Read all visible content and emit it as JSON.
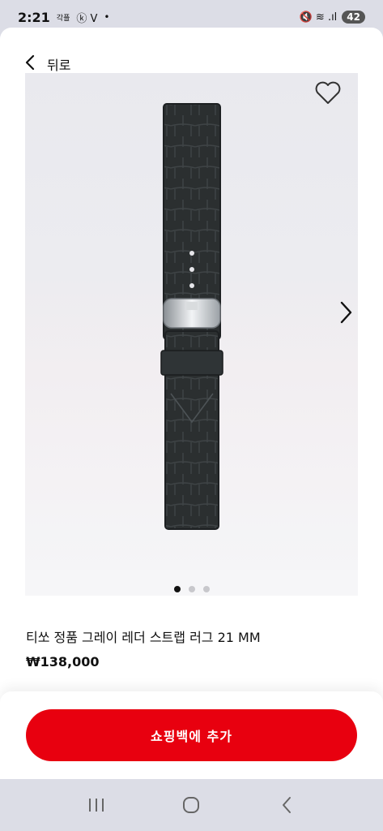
{
  "status_bar": {
    "time": "2:21",
    "carrier_label": "각플",
    "notif_icons": "ⓚ V",
    "dot": "•",
    "right_icons": "🔇 ≋ .ıl",
    "battery": "42"
  },
  "header": {
    "back_label": "뒤로"
  },
  "gallery": {
    "page_count": 3,
    "active_page": 1,
    "favorite": false
  },
  "product": {
    "name": "티쏘 정품 그레이 레더 스트랩 러그 21 MM",
    "price": "₩138,000"
  },
  "actions": {
    "add_to_bag_label": "쇼핑백에 추가"
  },
  "colors": {
    "accent": "#e8000f",
    "strap": "#2b2f30"
  },
  "icons": {
    "back": "chevron-left-icon",
    "favorite": "heart-icon",
    "next": "chevron-right-icon",
    "nav_recents": "recents-icon",
    "nav_home": "home-icon",
    "nav_back": "back-icon"
  }
}
